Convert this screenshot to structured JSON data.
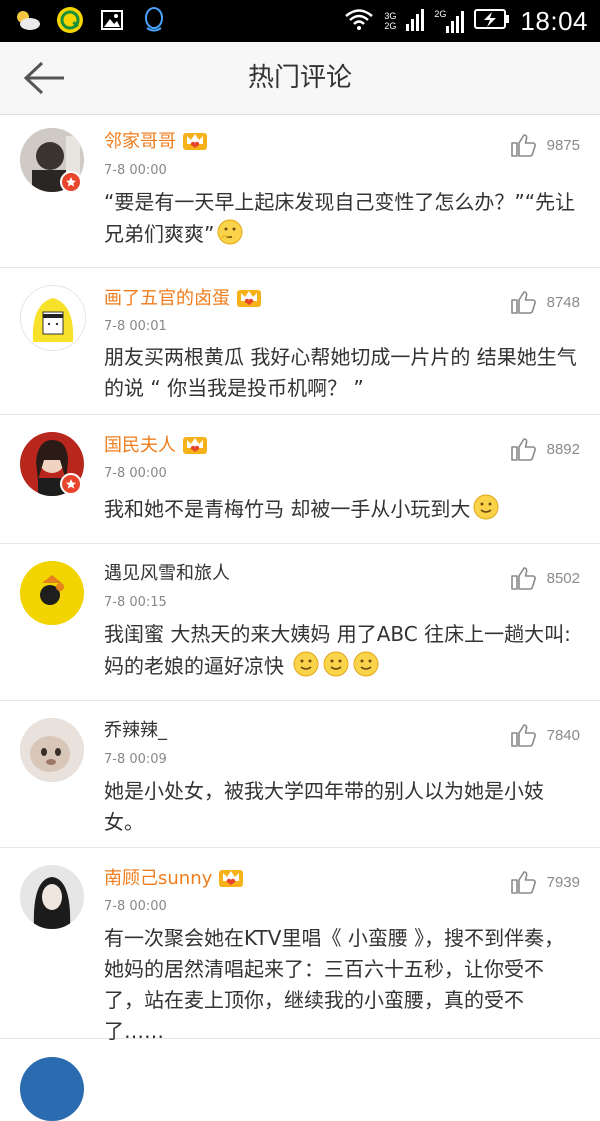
{
  "status_bar": {
    "network_top": "3G",
    "network_bottom": "2G",
    "network2": "2G",
    "time": "18:04"
  },
  "header": {
    "title": "热门评论"
  },
  "comments": [
    {
      "name": "邻家哥哥",
      "time": "7-8 00:00",
      "likes": "9875",
      "text": "“要是有一天早上起床发现自己变性了怎么办？”“先让兄弟们爽爽”",
      "vip": true
    },
    {
      "name": "画了五官的卤蛋",
      "time": "7-8 00:01",
      "likes": "8748",
      "text": "朋友买两根黄瓜 我好心帮她切成一片片的 结果她生气的说 “ 你当我是投币机啊？ ”",
      "vip": true
    },
    {
      "name": "国民夫人",
      "time": "7-8 00:00",
      "likes": "8892",
      "text": "我和她不是青梅竹马 却被一手从小玩到大",
      "vip": true
    },
    {
      "name": "遇见风雪和旅人",
      "time": "7-8 00:15",
      "likes": "8502",
      "text": "我闺蜜 大热天的来大姨妈 用了ABC 往床上一趟大叫:妈的老娘的逼好凉快",
      "vip": false
    },
    {
      "name": "乔辣辣_",
      "time": "7-8 00:09",
      "likes": "7840",
      "text": "她是小处女，被我大学四年带的别人以为她是小妓女。",
      "vip": false
    },
    {
      "name": "南顾己sunny",
      "time": "7-8 00:00",
      "likes": "7939",
      "text": "有一次聚会她在KTV里唱《 小蛮腰 》，搜不到伴奏，她妈的居然清唱起来了：三百六十五秒，让你受不了，站在麦上顶你，继续我的小蛮腰，真的受不了……",
      "vip": true
    }
  ]
}
